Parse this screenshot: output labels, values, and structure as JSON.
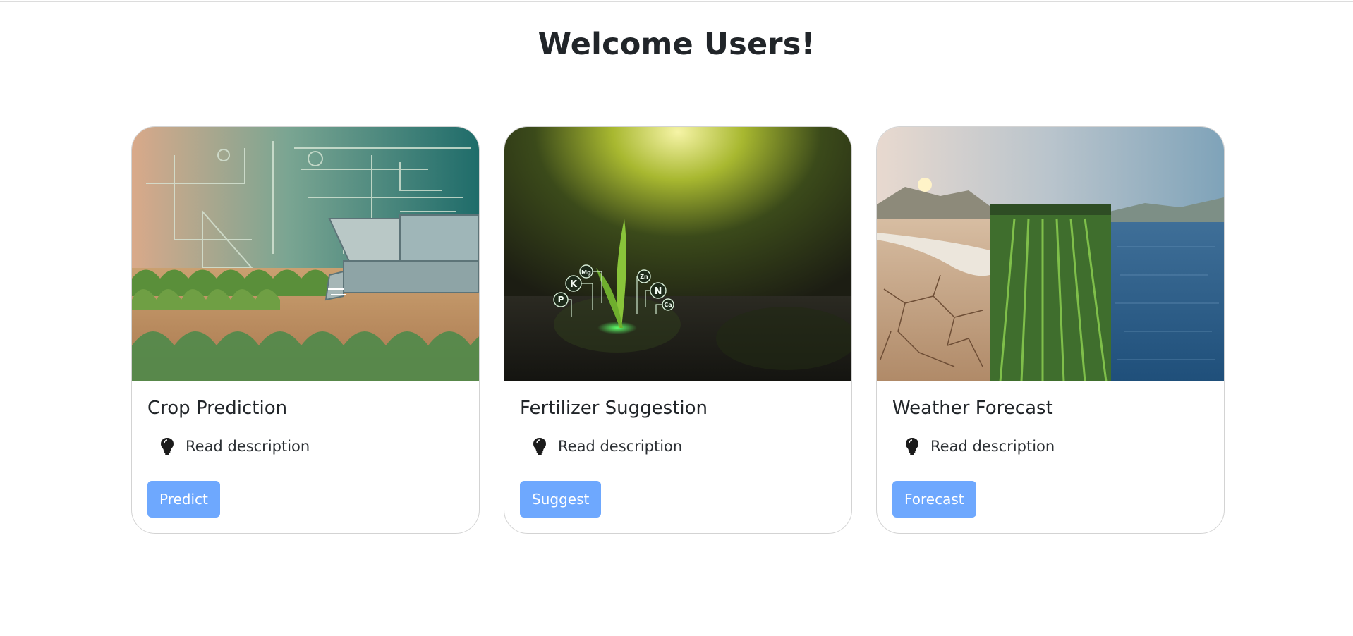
{
  "page": {
    "title": "Welcome Users!"
  },
  "cards": [
    {
      "title": "Crop Prediction",
      "description_link": "Read description",
      "button_label": "Predict",
      "image_icon": "smart-farm-machine-icon"
    },
    {
      "title": "Fertilizer Suggestion",
      "description_link": "Read description",
      "button_label": "Suggest",
      "image_icon": "seedling-nutrients-icon",
      "nutrient_labels": [
        "P",
        "K",
        "Mg",
        "Zn",
        "N",
        "Ca"
      ]
    },
    {
      "title": "Weather Forecast",
      "description_link": "Read description",
      "button_label": "Forecast",
      "image_icon": "weather-landscape-icon"
    }
  ],
  "colors": {
    "button": "#6ea8fe",
    "button_text": "#ffffff",
    "heading": "#212529",
    "card_border": "#d3d3d3"
  }
}
